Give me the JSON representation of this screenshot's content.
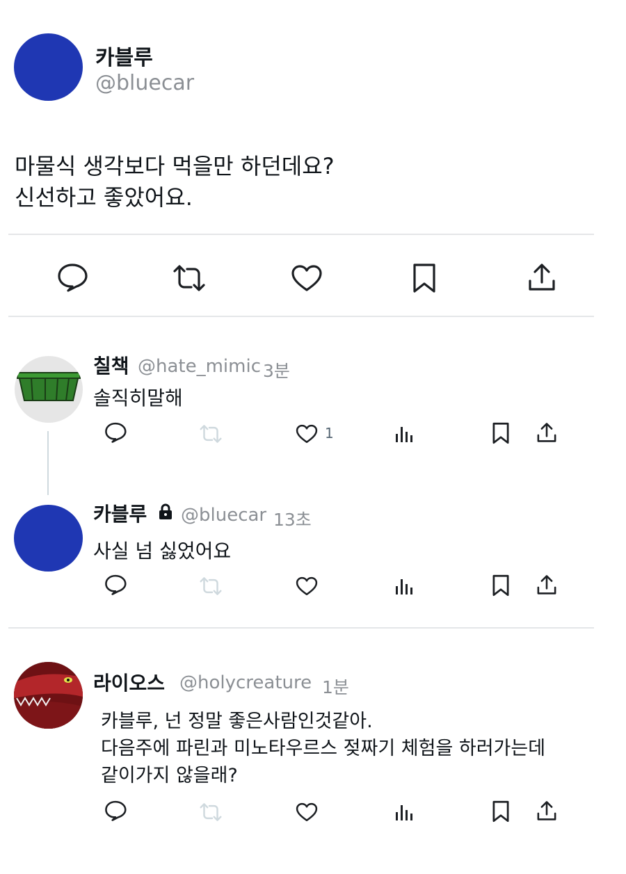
{
  "main_post": {
    "display_name": "카블루",
    "handle": "@bluecar",
    "text_line1": "마물식 생각보다 먹을만 하던데요?",
    "text_line2": "신선하고 좋았어요.",
    "avatar_color": "#1f37b3"
  },
  "action_bar": {
    "icons": [
      "reply-icon",
      "retweet-icon",
      "like-icon",
      "bookmark-icon",
      "share-icon"
    ]
  },
  "replies": [
    {
      "display_name": "칠책",
      "handle": "@hate_mimic",
      "time": "3분",
      "text": "솔직히말해",
      "like_count": "1"
    },
    {
      "display_name": "카블루",
      "handle": "@bluecar",
      "time": "13초",
      "text": "사실 넘 싫었어요",
      "locked": true
    },
    {
      "display_name": "라이오스",
      "handle": "@holycreature",
      "time": "1분",
      "text_line1": "카블루, 넌 정말 좋은사람인것같아.",
      "text_line2": "다음주에 파린과 미노타우르스 젖짜기 체험을 하러가는데",
      "text_line3": "같이가지 않을래?"
    }
  ],
  "colors": {
    "divider": "#e4e6e8",
    "muted_text": "#8b8f94",
    "icon_dark": "#1c1f23",
    "icon_faded": "#cfd9de",
    "blue_avatar": "#1f37b3",
    "mimic_green": "#2f7d2a"
  }
}
